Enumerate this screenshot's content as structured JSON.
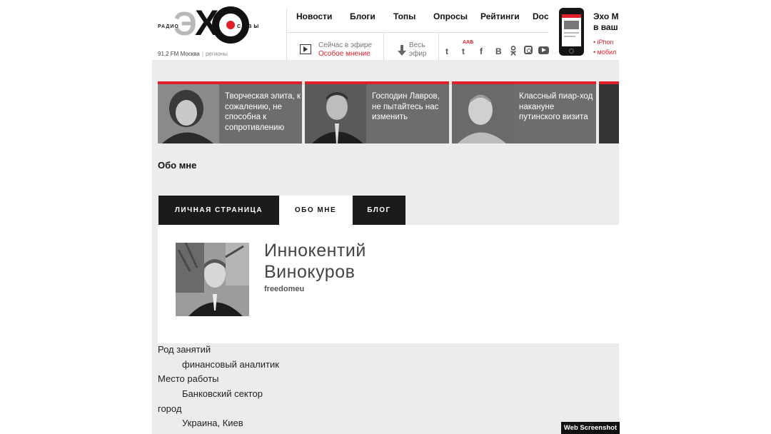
{
  "logo": {
    "radio": "РАДИО",
    "echo_e": "Э",
    "echo_x": "Х",
    "moskvy_m": "М",
    "moskvy_rest": "СКВЫ",
    "frequency": "91,2 FM Москва",
    "regions": "регионы"
  },
  "nav": {
    "items": [
      "Новости",
      "Блоги",
      "Топы",
      "Опросы",
      "Рейтинги",
      "Doc"
    ]
  },
  "on_air": {
    "label": "Сейчас в эфире",
    "program": "Особое мнение",
    "full_line1": "Весь",
    "full_line2": "эфир"
  },
  "social": {
    "aab": "ААБ",
    "icons": [
      "twitter-icon",
      "twitter-icon",
      "facebook-icon",
      "vk-icon",
      "odnoklassniki-icon",
      "instagram-icon",
      "youtube-icon"
    ],
    "glyph_t": "t",
    "glyph_f": "f",
    "glyph_b": "В"
  },
  "promo": {
    "title1": "Эхо М",
    "title2": "в ваш",
    "link1": "• iPhon",
    "link2": "• мобил"
  },
  "news_strip": [
    {
      "text": "Творческая элита, к сожалению, не способна к сопротивлению"
    },
    {
      "text": "Господин Лавров, не пытайтесь нас изменить"
    },
    {
      "text": "Классный пиар-ход накануне путинского визита"
    }
  ],
  "section_title": "Обо мне",
  "tabs": [
    {
      "label": "ЛИЧНАЯ СТРАНИЦА",
      "active": false
    },
    {
      "label": "ОБО МНЕ",
      "active": true
    },
    {
      "label": "БЛОГ",
      "active": false
    }
  ],
  "profile": {
    "first_name": "Иннокентий",
    "last_name": "Винокуров",
    "nickname": "freedomeu"
  },
  "details": [
    {
      "label": "Род занятий",
      "value": "финансовый аналитик"
    },
    {
      "label": "Место работы",
      "value": "Банковский сектор"
    },
    {
      "label": "город",
      "value": "Украина, Киев"
    }
  ],
  "watermark": "Web Screenshot",
  "colors": {
    "accent": "#e2202a",
    "dark": "#1b1b1b",
    "card": "#6d6d6d",
    "page_bg": "#ececec"
  }
}
